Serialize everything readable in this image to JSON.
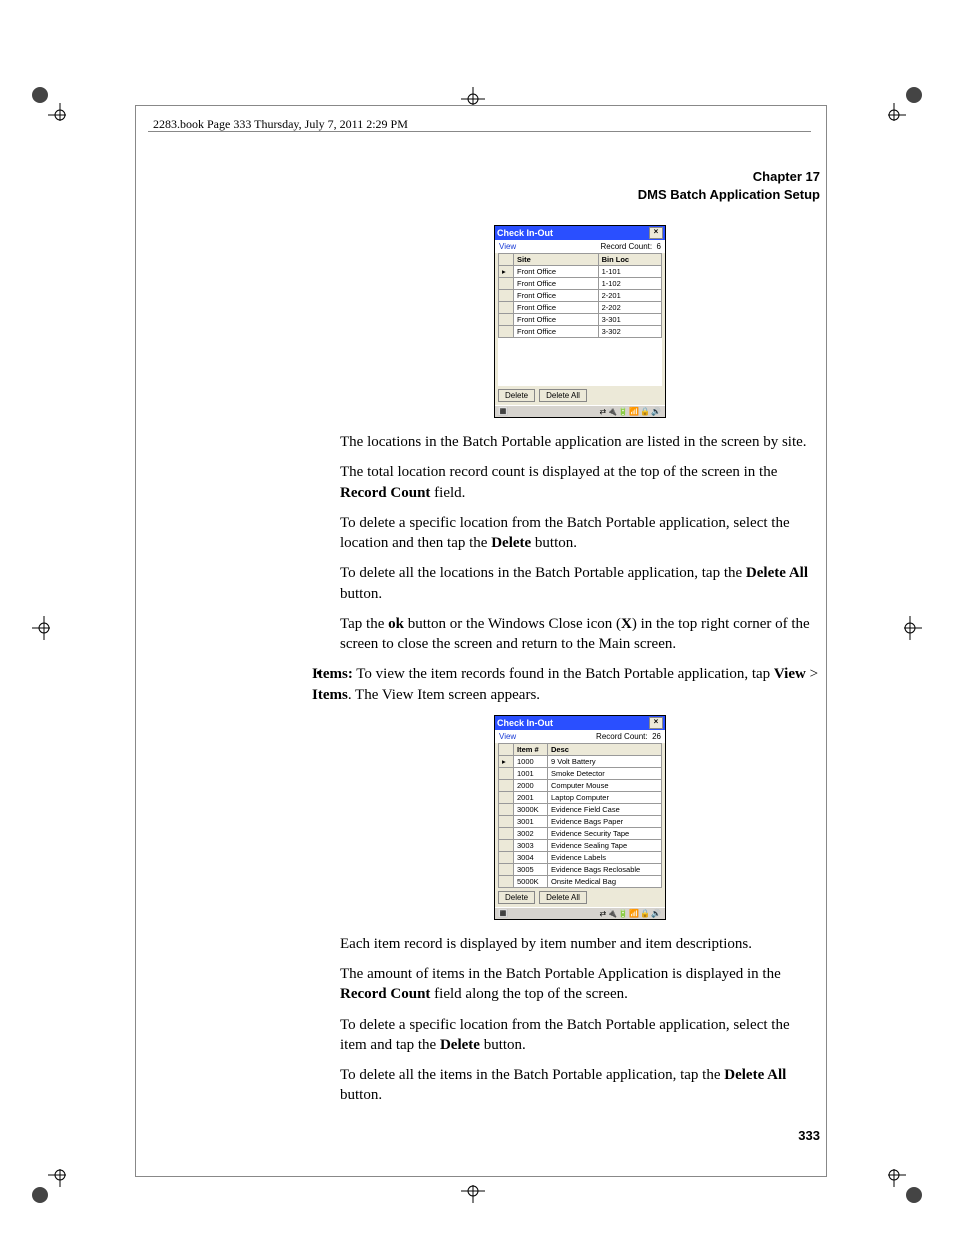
{
  "header_line": "2283.book  Page 333  Thursday, July 7, 2011  2:29 PM",
  "chapter": {
    "line1": "Chapter 17",
    "line2": "DMS Batch Application Setup"
  },
  "page_number": "333",
  "screenshot1": {
    "title": "Check In-Out",
    "close": "×",
    "view": "View",
    "record_count_label": "Record Count:",
    "record_count": "6",
    "col1": "Site",
    "col2": "Bin Loc",
    "rows": [
      {
        "c1": "Front Office",
        "c2": "1-101"
      },
      {
        "c1": "Front Office",
        "c2": "1-102"
      },
      {
        "c1": "Front Office",
        "c2": "2-201"
      },
      {
        "c1": "Front Office",
        "c2": "2-202"
      },
      {
        "c1": "Front Office",
        "c2": "3-301"
      },
      {
        "c1": "Front Office",
        "c2": "3-302"
      }
    ],
    "delete": "Delete",
    "delete_all": "Delete All",
    "tray_start": "🔳",
    "tray_icons": "⇄🔌🔋📶🔒🔊"
  },
  "paragraphs_a": {
    "p1": "The locations in the Batch Portable application are listed in the screen by site.",
    "p2a": "The total location record count is displayed at the top of the screen in the ",
    "p2b": "Record Count",
    "p2c": " field.",
    "p3a": "To delete a specific location from the Batch Portable application, select the location and then tap the ",
    "p3b": "Delete",
    "p3c": " button.",
    "p4a": "To delete all the locations in the Batch Portable application, tap the ",
    "p4b": "Delete All",
    "p4c": " button.",
    "p5a": "Tap the ",
    "p5b": "ok",
    "p5c": " button or the Windows Close icon (",
    "p5d": "X",
    "p5e": ") in the top right corner of the screen to close the screen and return to the Main screen."
  },
  "bullet": {
    "b1": "Items:",
    "b2": " To view the item records found in the Batch Portable application, tap ",
    "b3": "View",
    "b4": " > ",
    "b5": "Items",
    "b6": ". The View Item screen appears."
  },
  "screenshot2": {
    "title": "Check In-Out",
    "close": "×",
    "view": "View",
    "record_count_label": "Record Count:",
    "record_count": "26",
    "col1": "Item #",
    "col2": "Desc",
    "rows": [
      {
        "c1": "1000",
        "c2": "9 Volt Battery"
      },
      {
        "c1": "1001",
        "c2": "Smoke Detector"
      },
      {
        "c1": "2000",
        "c2": "Computer Mouse"
      },
      {
        "c1": "2001",
        "c2": "Laptop Computer"
      },
      {
        "c1": "3000K",
        "c2": "Evidence Field Case"
      },
      {
        "c1": "3001",
        "c2": "Evidence Bags Paper"
      },
      {
        "c1": "3002",
        "c2": "Evidence Security Tape"
      },
      {
        "c1": "3003",
        "c2": "Evidence Sealing Tape"
      },
      {
        "c1": "3004",
        "c2": "Evidence Labels"
      },
      {
        "c1": "3005",
        "c2": "Evidence Bags Reclosable"
      },
      {
        "c1": "5000K",
        "c2": "Onsite Medical Bag"
      }
    ],
    "delete": "Delete",
    "delete_all": "Delete All",
    "tray_start": "🔳",
    "tray_icons": "⇄🔌🔋📶🔒🔊"
  },
  "paragraphs_b": {
    "p1": "Each item record is displayed by item number and item descriptions.",
    "p2a": "The amount of items in the Batch Portable Application is displayed in the ",
    "p2b": "Record Count",
    "p2c": " field along the top of the screen.",
    "p3a": "To delete a specific location from the Batch Portable application, select the item and tap the ",
    "p3b": "Delete",
    "p3c": " button.",
    "p4a": "To delete all the items in the Batch Portable application, tap the ",
    "p4b": "Delete All",
    "p4c": " button."
  }
}
